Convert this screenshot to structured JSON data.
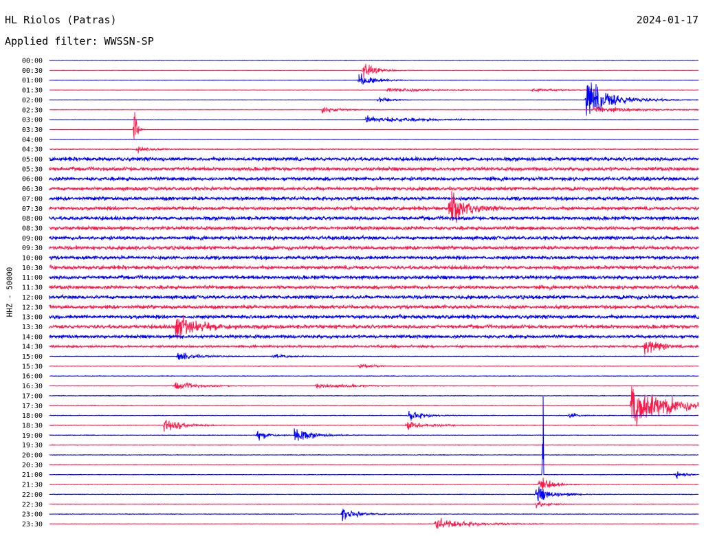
{
  "header": {
    "station": "HL Riolos (Patras)",
    "date": "2024-01-17",
    "filter": "Applied filter: WWSSN-SP"
  },
  "colors": {
    "odd_trace": "#0000ff",
    "even_trace": "#ff1a4b",
    "background": "#ffffff"
  },
  "chart_data": {
    "type": "line",
    "title": "HL Riolos (Patras)",
    "ylabel": "HHZ - 50000",
    "xlabel": "",
    "grid": false,
    "time_labels": [
      "00:00",
      "00:30",
      "01:00",
      "01:30",
      "02:00",
      "02:30",
      "03:00",
      "03:30",
      "04:00",
      "04:30",
      "05:00",
      "05:30",
      "06:00",
      "06:30",
      "07:00",
      "07:30",
      "08:00",
      "08:30",
      "09:00",
      "09:30",
      "10:00",
      "10:30",
      "11:00",
      "11:30",
      "12:00",
      "12:30",
      "13:00",
      "13:30",
      "14:00",
      "14:30",
      "15:00",
      "15:30",
      "16:00",
      "16:30",
      "17:00",
      "17:30",
      "18:00",
      "18:30",
      "19:00",
      "19:30",
      "20:00",
      "20:30",
      "21:00",
      "21:30",
      "22:00",
      "22:30",
      "23:00",
      "23:30"
    ],
    "noise_level": [
      0.15,
      0.15,
      0.15,
      0.15,
      0.15,
      0.15,
      0.15,
      0.15,
      0.15,
      0.5,
      2.2,
      2.2,
      2.2,
      2.2,
      2.2,
      2.2,
      2.2,
      2.2,
      2.2,
      2.2,
      2.2,
      2.2,
      2.2,
      2.2,
      2.2,
      2.2,
      2.2,
      2.2,
      2.0,
      1.2,
      0.3,
      0.3,
      0.3,
      0.3,
      0.3,
      0.3,
      0.3,
      0.3,
      0.3,
      0.3,
      0.3,
      0.3,
      0.3,
      0.3,
      0.3,
      0.3,
      0.3,
      0.3
    ],
    "events": [
      {
        "row": 1,
        "minute": 14.5,
        "amplitude": 12,
        "duration": 1.2
      },
      {
        "row": 2,
        "minute": 14.3,
        "amplitude": 9,
        "duration": 1.5
      },
      {
        "row": 3,
        "minute": 15.6,
        "amplitude": 4,
        "duration": 3
      },
      {
        "row": 3,
        "minute": 22.3,
        "amplitude": 3,
        "duration": 2
      },
      {
        "row": 4,
        "minute": 15.2,
        "amplitude": 5,
        "duration": 1
      },
      {
        "row": 4,
        "minute": 24.8,
        "amplitude": 26,
        "duration": 2.5
      },
      {
        "row": 5,
        "minute": 12.6,
        "amplitude": 6,
        "duration": 1.5
      },
      {
        "row": 5,
        "minute": 25.1,
        "amplitude": 5,
        "duration": 4
      },
      {
        "row": 6,
        "minute": 14.6,
        "amplitude": 5,
        "duration": 5
      },
      {
        "row": 7,
        "minute": 3.9,
        "amplitude": 60,
        "duration": 0.2
      },
      {
        "row": 9,
        "minute": 4.0,
        "amplitude": 6,
        "duration": 1
      },
      {
        "row": 15,
        "minute": 18.5,
        "amplitude": 30,
        "duration": 1.2
      },
      {
        "row": 27,
        "minute": 5.8,
        "amplitude": 18,
        "duration": 2
      },
      {
        "row": 29,
        "minute": 27.5,
        "amplitude": 10,
        "duration": 1.5
      },
      {
        "row": 30,
        "minute": 5.9,
        "amplitude": 6,
        "duration": 2
      },
      {
        "row": 30,
        "minute": 10.3,
        "amplitude": 4,
        "duration": 1.5
      },
      {
        "row": 31,
        "minute": 14.3,
        "amplitude": 3,
        "duration": 1.5
      },
      {
        "row": 33,
        "minute": 5.8,
        "amplitude": 6,
        "duration": 2
      },
      {
        "row": 33,
        "minute": 12.3,
        "amplitude": 4,
        "duration": 3
      },
      {
        "row": 35,
        "minute": 26.9,
        "amplitude": 36,
        "duration": 3
      },
      {
        "row": 36,
        "minute": 16.6,
        "amplitude": 9,
        "duration": 1.2
      },
      {
        "row": 36,
        "minute": 24.0,
        "amplitude": 6,
        "duration": 0.8
      },
      {
        "row": 37,
        "minute": 5.3,
        "amplitude": 13,
        "duration": 1.5
      },
      {
        "row": 37,
        "minute": 16.5,
        "amplitude": 6,
        "duration": 2
      },
      {
        "row": 38,
        "minute": 9.6,
        "amplitude": 8,
        "duration": 1
      },
      {
        "row": 38,
        "minute": 11.3,
        "amplitude": 12,
        "duration": 1.5
      },
      {
        "row": 42,
        "minute": 28.9,
        "amplitude": 6,
        "duration": 1
      },
      {
        "row": 43,
        "minute": 22.6,
        "amplitude": 14,
        "duration": 1
      },
      {
        "row": 44,
        "minute": 22.5,
        "amplitude": 12,
        "duration": 1.5
      },
      {
        "row": 45,
        "minute": 22.5,
        "amplitude": 6,
        "duration": 1
      },
      {
        "row": 46,
        "minute": 13.5,
        "amplitude": 9,
        "duration": 1.5
      },
      {
        "row": 47,
        "minute": 17.8,
        "amplitude": 9,
        "duration": 3
      }
    ],
    "spikes": [
      {
        "row": 42,
        "minute": 22.8,
        "amplitude": 115
      }
    ]
  }
}
